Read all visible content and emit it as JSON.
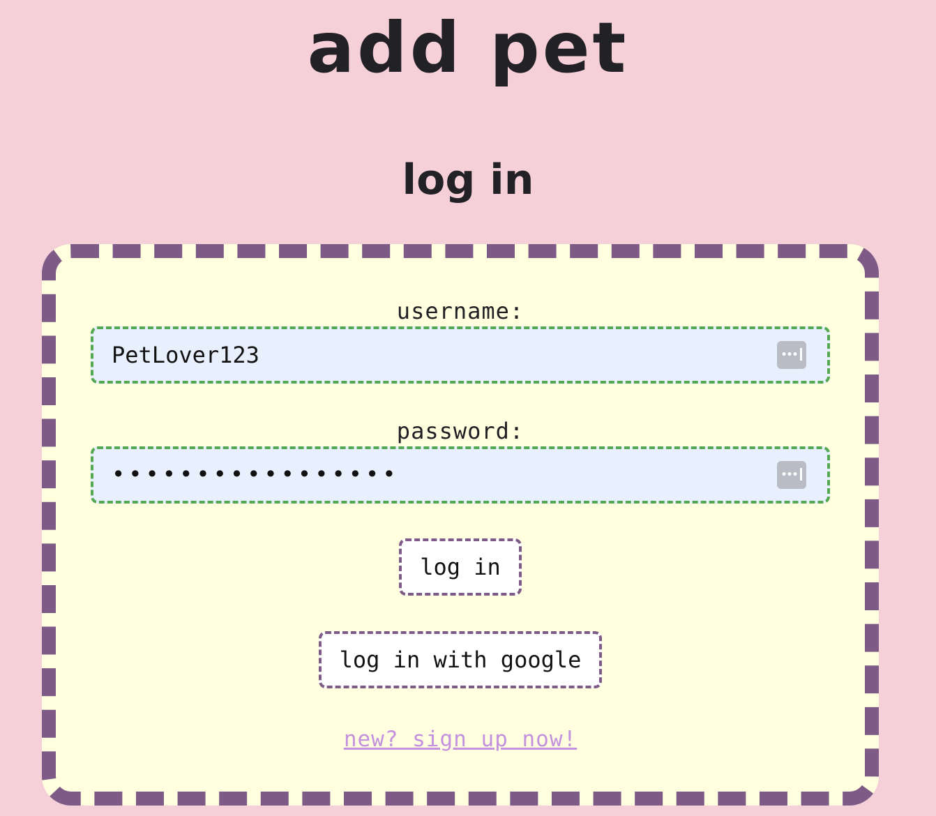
{
  "header": {
    "app_title": "add pet",
    "page_heading": "log in"
  },
  "form": {
    "username": {
      "label": "username:",
      "value": "PetLover123"
    },
    "password": {
      "label": "password:",
      "masked_value": "•••••••••••••••••"
    },
    "login_button": "log in",
    "google_button": "log in with google",
    "signup_link": "new? sign up now!"
  },
  "icons": {
    "autofill": "password-manager-key-icon"
  },
  "colors": {
    "background": "#f6d0d8",
    "card_background": "#ffffe0",
    "card_border": "#7e5a87",
    "field_border": "#55a853",
    "field_background": "#e8f0fe",
    "link": "#c391dd"
  }
}
